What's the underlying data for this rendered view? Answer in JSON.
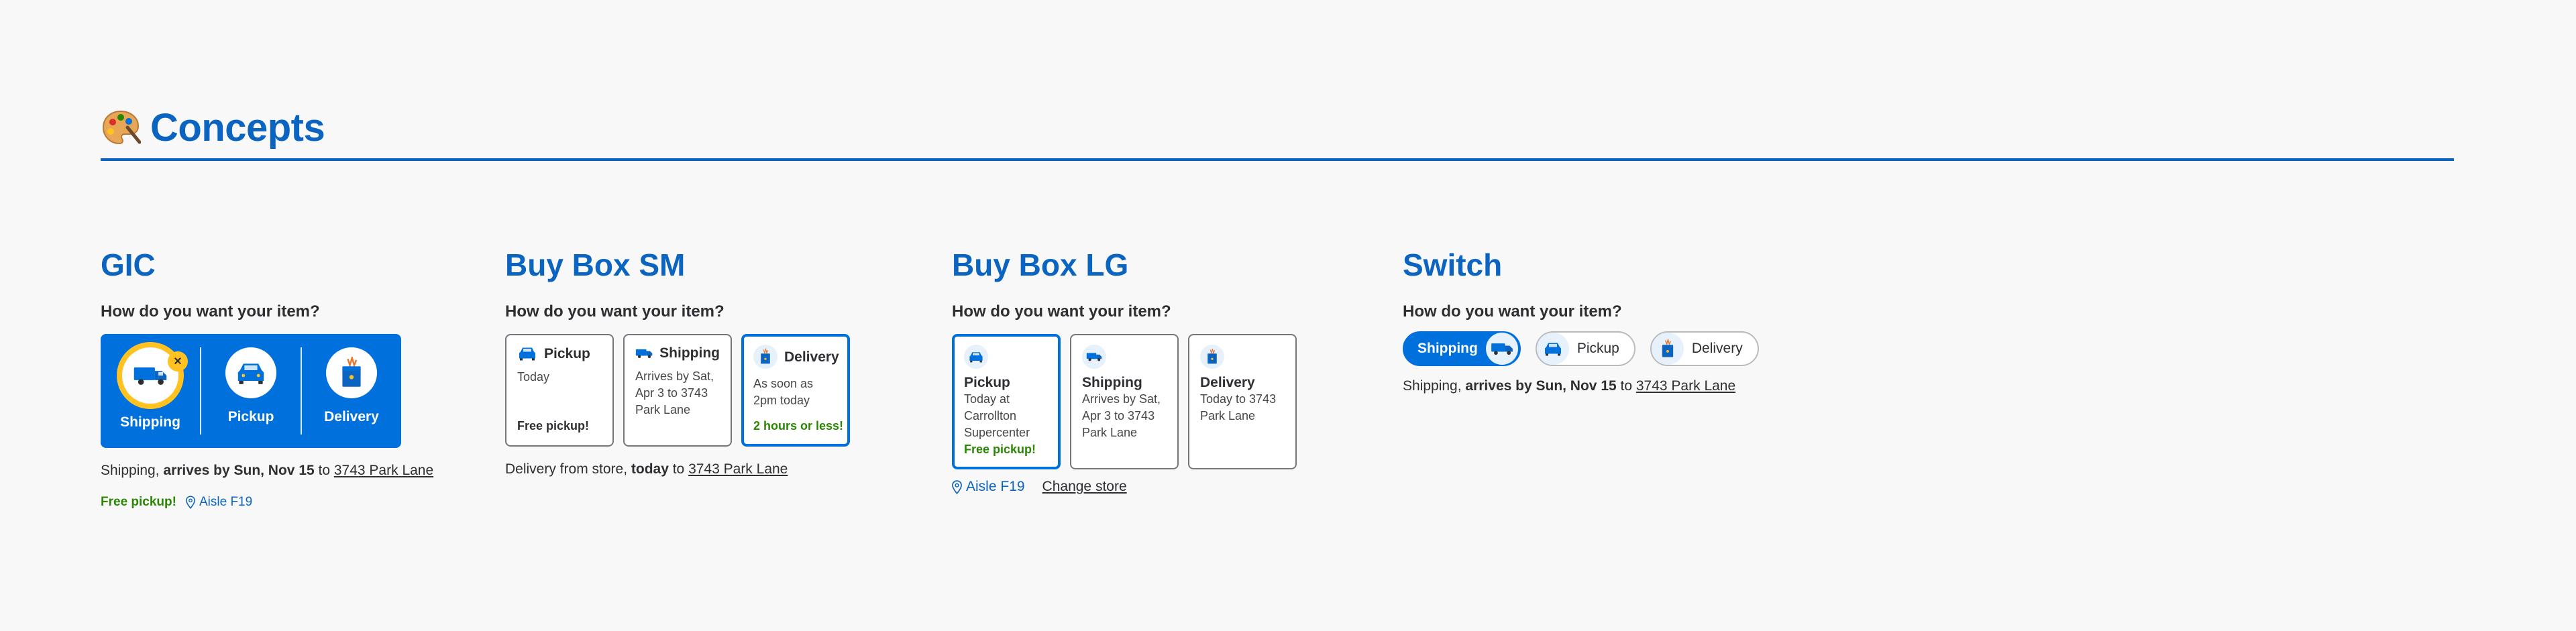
{
  "header": {
    "title": "Concepts"
  },
  "colors": {
    "brand_blue": "#0071dc",
    "title_blue": "#0b64c0",
    "accent_yellow": "#ffc220",
    "success_green": "#2a8703"
  },
  "gic": {
    "title": "GIC",
    "question": "How do you want your item?",
    "options": [
      {
        "label": "Shipping",
        "icon": "truck-icon",
        "selected": true
      },
      {
        "label": "Pickup",
        "icon": "car-icon",
        "selected": false
      },
      {
        "label": "Delivery",
        "icon": "bag-icon",
        "selected": false
      }
    ],
    "info": {
      "prefix": "Shipping, ",
      "bold": "arrives by Sun, Nov 15",
      "mid": " to ",
      "link": "3743 Park Lane"
    },
    "free": "Free pickup!",
    "aisle": "Aisle F19"
  },
  "buybox_sm": {
    "title": "Buy Box SM",
    "question": "How do you want your item?",
    "tiles": [
      {
        "name": "Pickup",
        "sub": "Today",
        "foot": "Free pickup!",
        "selected": false
      },
      {
        "name": "Shipping",
        "sub": "Arrives by Sat, Apr 3 to 3743 Park Lane",
        "foot": "",
        "selected": false
      },
      {
        "name": "Delivery",
        "sub": "As soon as 2pm today",
        "foot": "2 hours or less!",
        "selected": true
      }
    ],
    "info": {
      "prefix": "Delivery from store, ",
      "bold": "today",
      "mid": " to ",
      "link": "3743 Park Lane"
    }
  },
  "buybox_lg": {
    "title": "Buy Box LG",
    "question": "How do you want your item?",
    "tiles": [
      {
        "name": "Pickup",
        "sub": "Today at Carrollton Supercenter",
        "foot": "Free pickup!",
        "selected": true
      },
      {
        "name": "Shipping",
        "sub": "Arrives by Sat, Apr 3 to 3743 Park Lane",
        "foot": "",
        "selected": false
      },
      {
        "name": "Delivery",
        "sub": "Today to 3743 Park Lane",
        "foot": "",
        "selected": false
      }
    ],
    "aisle": "Aisle F19",
    "change_store": "Change store"
  },
  "switch": {
    "title": "Switch",
    "question": "How do you want your item?",
    "pills": [
      {
        "label": "Shipping",
        "selected": true
      },
      {
        "label": "Pickup",
        "selected": false
      },
      {
        "label": "Delivery",
        "selected": false
      }
    ],
    "info": {
      "prefix": "Shipping, ",
      "bold": "arrives by Sun, Nov 15",
      "mid": " to ",
      "link": "3743 Park Lane"
    }
  }
}
